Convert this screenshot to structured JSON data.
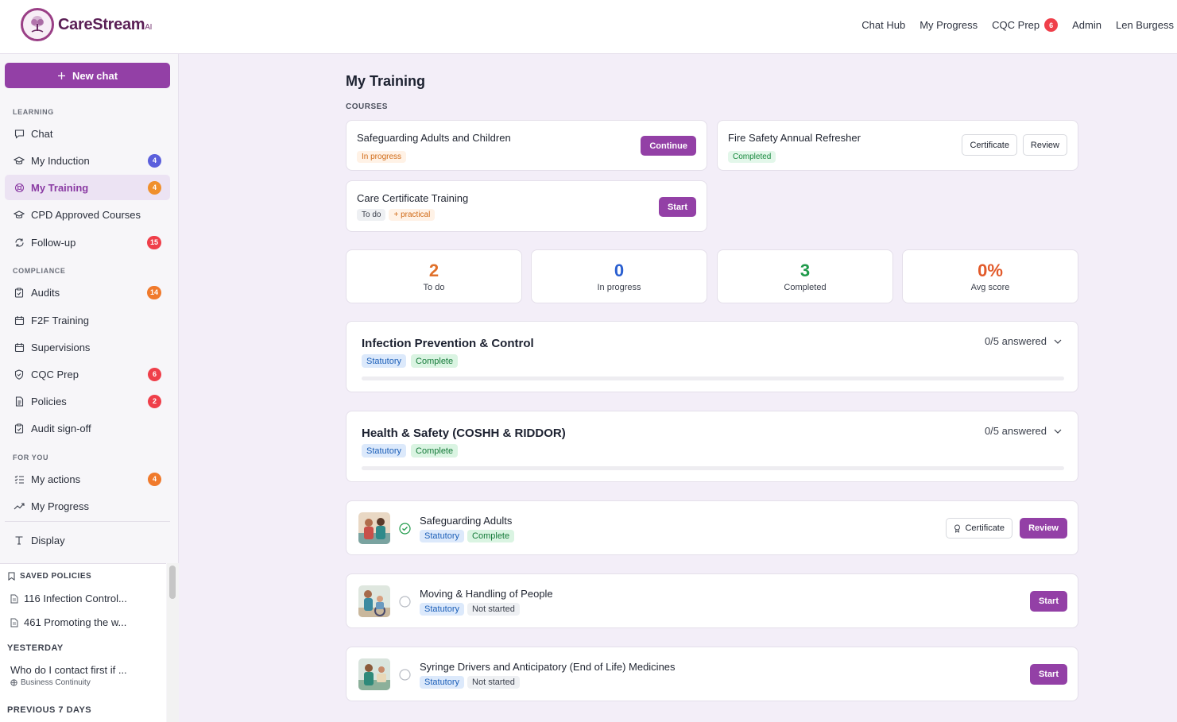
{
  "app": {
    "name": "CareStream",
    "name_suffix": "AI"
  },
  "topnav": [
    {
      "label": "Chat Hub"
    },
    {
      "label": "My Progress"
    },
    {
      "label": "CQC Prep",
      "badge": "6"
    },
    {
      "label": "Admin"
    },
    {
      "label": "Len Burgess"
    }
  ],
  "sidebar": {
    "new_chat": "New chat",
    "sections": {
      "learning": "LEARNING",
      "compliance": "COMPLIANCE",
      "for_you": "FOR YOU"
    },
    "items": [
      {
        "label": "Chat",
        "icon": "chat-bubble-icon"
      },
      {
        "label": "My Induction",
        "icon": "graduation-cap-icon",
        "badge": "4"
      },
      {
        "label": "My Training",
        "icon": "lifebuoy-icon",
        "badge": "4",
        "active": true
      },
      {
        "label": "CPD Approved Courses",
        "icon": "graduation-cap-icon"
      },
      {
        "label": "Follow-up",
        "icon": "refresh-icon",
        "badge": "15"
      },
      {
        "label": "Audits",
        "icon": "clipboard-icon",
        "badge": "14"
      },
      {
        "label": "F2F Training",
        "icon": "calendar-icon"
      },
      {
        "label": "Supervisions",
        "icon": "calendar-icon"
      },
      {
        "label": "CQC Prep",
        "icon": "shield-check-icon",
        "badge": "6"
      },
      {
        "label": "Policies",
        "icon": "document-icon",
        "badge": "2"
      },
      {
        "label": "Audit sign-off",
        "icon": "clipboard-check-icon"
      },
      {
        "label": "My actions",
        "icon": "list-check-icon",
        "badge": "4"
      },
      {
        "label": "My Progress",
        "icon": "trend-up-icon"
      },
      {
        "label": "Display",
        "icon": "text-t-icon"
      }
    ],
    "saved": {
      "title": "SAVED POLICIES",
      "items": [
        "116 Infection Control...",
        "461 Promoting the w..."
      ],
      "yesterday": "YESTERDAY",
      "chat_title": "Who do I contact first if ...",
      "chat_sub": "Business Continuity",
      "prev7": "PREVIOUS 7 DAYS"
    }
  },
  "main": {
    "title": "My Training",
    "courses_label": "COURSES",
    "courses": [
      {
        "title": "Safeguarding Adults and Children",
        "status": "In progress",
        "action": "Continue"
      },
      {
        "title": "Fire Safety Annual Refresher",
        "status": "Completed",
        "actions": [
          "Certificate",
          "Review"
        ]
      },
      {
        "title": "Care Certificate Training",
        "status": "To do",
        "extra": "+ practical",
        "action": "Start"
      }
    ],
    "stats": [
      {
        "value": "2",
        "label": "To do",
        "color": "#e0702a"
      },
      {
        "value": "0",
        "label": "In progress",
        "color": "#2a5fd0"
      },
      {
        "value": "3",
        "label": "Completed",
        "color": "#1f9a4a"
      },
      {
        "value": "0%",
        "label": "Avg score",
        "color": "#e25a2a"
      }
    ],
    "quizzes": [
      {
        "title": "Infection Prevention & Control",
        "tags": [
          "Statutory",
          "Complete"
        ],
        "answered": "0/5 answered",
        "progress": 0
      },
      {
        "title": "Health & Safety (COSHH & RIDDOR)",
        "tags": [
          "Statutory",
          "Complete"
        ],
        "answered": "0/5 answered",
        "progress": 0
      }
    ],
    "modules": [
      {
        "title": "Safeguarding Adults",
        "tags": [
          "Statutory",
          "Complete"
        ],
        "done": true,
        "actions": [
          "Certificate",
          "Review"
        ]
      },
      {
        "title": "Moving & Handling of People",
        "tags": [
          "Statutory",
          "Not started"
        ],
        "done": false,
        "actions": [
          "Start"
        ]
      },
      {
        "title": "Syringe Drivers and Anticipatory (End of Life) Medicines",
        "tags": [
          "Statutory",
          "Not started"
        ],
        "done": false,
        "actions": [
          "Start"
        ]
      }
    ]
  }
}
